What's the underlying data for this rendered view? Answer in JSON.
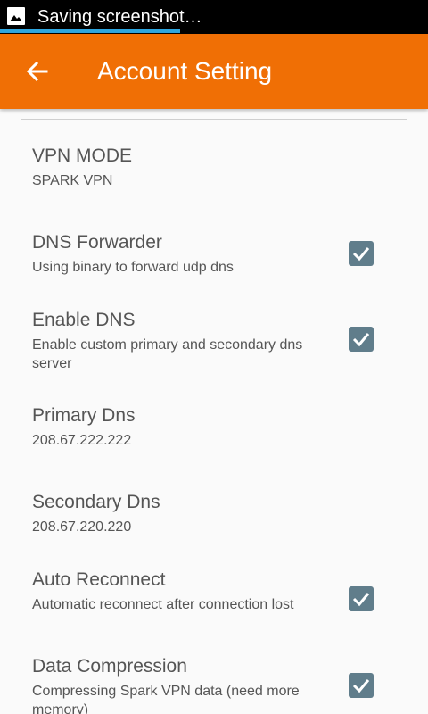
{
  "statusbar": {
    "icon": "image-icon",
    "text": "Saving screenshot…",
    "progress": 0.42,
    "progress_color": "#2ea6e0"
  },
  "appbar": {
    "back_icon": "arrow-left-icon",
    "title": "Account Setting",
    "color": "#f06f05"
  },
  "settings": {
    "vpn_mode": {
      "title": "VPN MODE",
      "summary": "SPARK VPN"
    },
    "dns_forwarder": {
      "title": "DNS Forwarder",
      "summary": "Using binary to forward udp dns",
      "checked": true
    },
    "enable_dns": {
      "title": "Enable DNS",
      "summary": "Enable custom primary and secondary dns server",
      "checked": true
    },
    "primary_dns": {
      "title": "Primary Dns",
      "summary": "208.67.222.222"
    },
    "secondary_dns": {
      "title": "Secondary Dns",
      "summary": "208.67.220.220"
    },
    "auto_reconnect": {
      "title": "Auto Reconnect",
      "summary": "Automatic reconnect after connection lost",
      "checked": true
    },
    "data_compression": {
      "title": "Data Compression",
      "summary": "Compressing Spark VPN data (need more memory)",
      "checked": true
    }
  },
  "colors": {
    "checkbox": "#607d8b"
  }
}
